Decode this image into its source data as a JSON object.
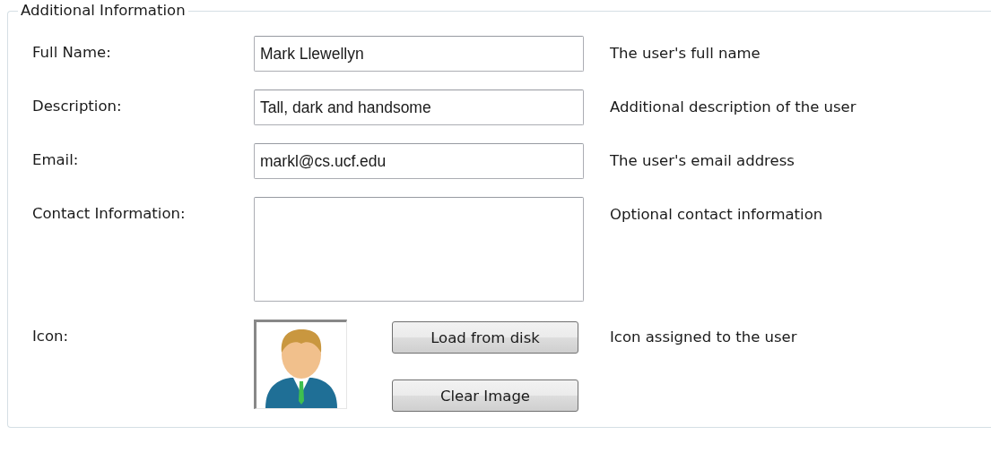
{
  "group": {
    "title": "Additional Information"
  },
  "rows": [
    {
      "kind": "text",
      "label": "Full Name:",
      "value": "Mark Llewellyn",
      "help": "The user's full name"
    },
    {
      "kind": "text",
      "label": "Description:",
      "value": "Tall, dark and handsome",
      "help": "Additional description of the user"
    },
    {
      "kind": "text",
      "label": "Email:",
      "value": "markl@cs.ucf.edu",
      "help": "The user's email address"
    },
    {
      "kind": "textarea",
      "label": "Contact Information:",
      "help": "Optional contact information"
    },
    {
      "kind": "icon",
      "label": "Icon:",
      "buttons": [
        "Load from disk",
        "Clear Image"
      ],
      "help": "Icon assigned to the user"
    }
  ]
}
